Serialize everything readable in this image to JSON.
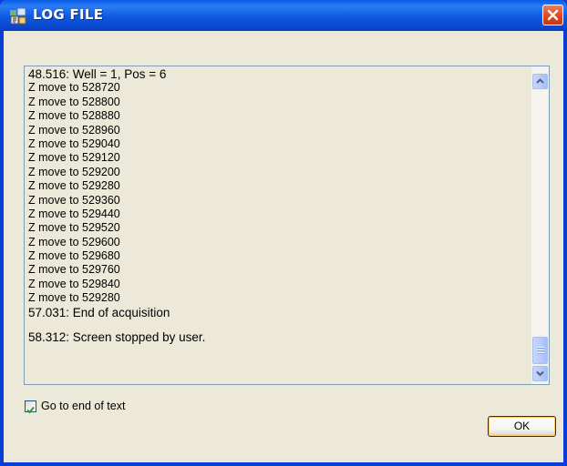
{
  "window": {
    "title": "LOG FILE",
    "close_icon": "close-icon",
    "app_icon": "app-icon"
  },
  "log": {
    "lines": [
      "48.516: Well = 1, Pos = 6",
      "Z move to 528720",
      "Z move to 528800",
      "Z move to 528880",
      "Z move to 528960",
      "Z move to 529040",
      "Z move to 529120",
      "Z move to 529200",
      "Z move to 529280",
      "Z move to 529360",
      "Z move to 529440",
      "Z move to 529520",
      "Z move to 529600",
      "Z move to 529680",
      "Z move to 529760",
      "Z move to 529840",
      "Z move to 529280",
      "57.031: End of acquisition",
      "",
      "58.312: Screen stopped by user."
    ]
  },
  "options": {
    "go_to_end_label": "Go to end of text",
    "go_to_end_checked": true
  },
  "buttons": {
    "ok_label": "OK"
  },
  "colors": {
    "titlebar": "#0a58e0",
    "client_bg": "#ece9d8",
    "close_button": "#d8461f"
  }
}
